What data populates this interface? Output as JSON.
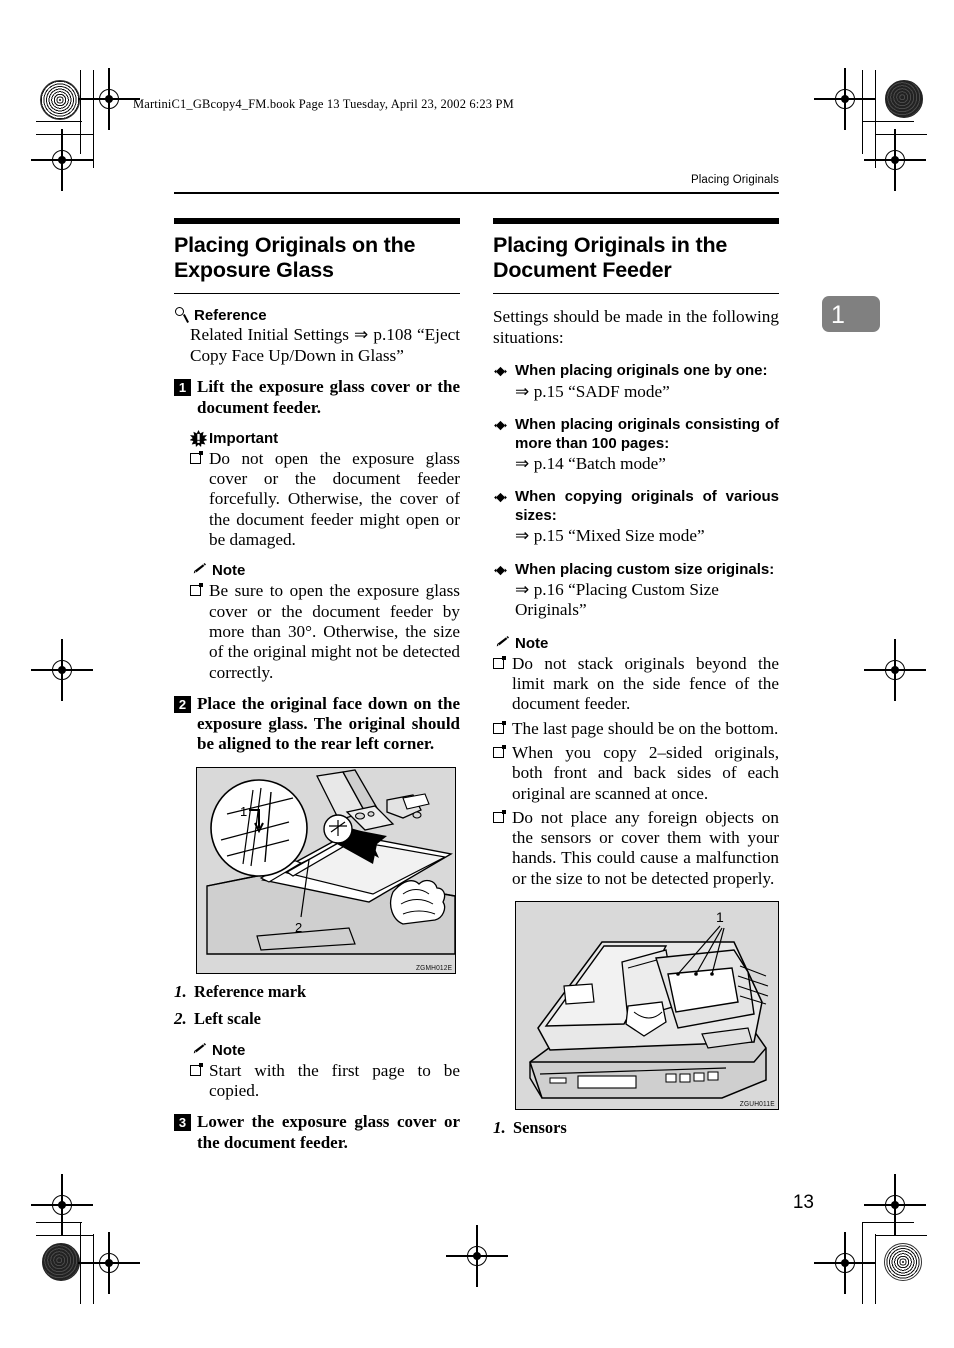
{
  "page": {
    "file_header": "MartiniC1_GBcopy4_FM.book  Page 13  Tuesday, April 23, 2002  6:23 PM",
    "running_head": "Placing Originals",
    "page_number": "13",
    "chapter_tab": "1"
  },
  "left_column": {
    "title": "Placing Originals on the Exposure Glass",
    "reference": {
      "icon": "magnifier-icon",
      "label": "Reference",
      "text": "Related Initial Settings ⇒ p.108 “Eject Copy Face Up/Down in Glass”"
    },
    "step1": {
      "number": "1",
      "text": "Lift the exposure glass cover or the document feeder."
    },
    "important": {
      "icon": "starburst-icon",
      "label": "Important",
      "items": [
        "Do not open the exposure glass cover or the document feeder forcefully. Otherwise, the cover of the document feeder might open or be damaged."
      ]
    },
    "note1": {
      "icon": "pencil-icon",
      "label": "Note",
      "items": [
        "Be sure to open the exposure glass cover or the document feeder by more than 30°. Otherwise, the size of the original might not be detected correctly."
      ]
    },
    "step2": {
      "number": "2",
      "text": "Place the original face down on the exposure glass. The original should be aligned to the rear left corner."
    },
    "figure1": {
      "name": "exposure-glass-illustration",
      "code": "ZGMH012E",
      "callouts": [
        "1",
        "2"
      ]
    },
    "figure1_captions": [
      {
        "num": "1.",
        "text": "Reference mark"
      },
      {
        "num": "2.",
        "text": "Left scale"
      }
    ],
    "note2": {
      "icon": "pencil-icon",
      "label": "Note",
      "items": [
        "Start with the first page to be copied."
      ]
    },
    "step3": {
      "number": "3",
      "text": "Lower the exposure glass cover or the document feeder."
    }
  },
  "right_column": {
    "title": "Placing Originals in the Document Feeder",
    "intro": "Settings should be made in the following situations:",
    "situations": [
      {
        "heading": "When placing originals one by one:",
        "reference": "⇒ p.15 “SADF mode”"
      },
      {
        "heading": "When placing originals consisting of more than 100 pages:",
        "reference": "⇒ p.14 “Batch mode”"
      },
      {
        "heading": "When copying originals of various sizes:",
        "reference": "⇒ p.15 “Mixed Size mode”"
      },
      {
        "heading": "When placing custom size originals:",
        "reference": "⇒ p.16 “Placing Custom Size Originals”"
      }
    ],
    "note": {
      "icon": "pencil-icon",
      "label": "Note",
      "items": [
        "Do not stack originals beyond the limit mark on the side fence of the document feeder.",
        "The last page should be on the bottom.",
        "When you copy 2–sided originals, both front and back sides of each original are scanned at once.",
        "Do not place any foreign objects on the sensors or cover them with your hands. This could cause a malfunction or the size to not be detected properly."
      ]
    },
    "figure2": {
      "name": "document-feeder-illustration",
      "code": "ZGUH011E",
      "callouts": [
        "1"
      ]
    },
    "figure2_captions": [
      {
        "num": "1.",
        "text": "Sensors"
      }
    ]
  },
  "colors": {
    "figure_background": "#d9d9d9",
    "chapter_tab": "#808080",
    "text": "#000000"
  }
}
